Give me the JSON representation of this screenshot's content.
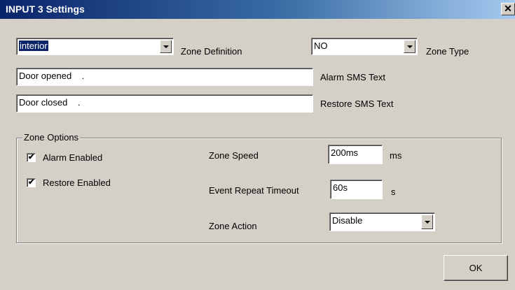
{
  "window": {
    "title": "INPUT 3 Settings",
    "close_glyph": "✕"
  },
  "zone_definition": {
    "value": "interior",
    "label": "Zone Definition"
  },
  "zone_type": {
    "value": "NO",
    "label": "Zone Type"
  },
  "alarm_sms": {
    "value": "Door opened    .",
    "label": "Alarm SMS Text"
  },
  "restore_sms": {
    "value": "Door closed    .",
    "label": "Restore SMS Text"
  },
  "zone_options": {
    "legend": "Zone Options",
    "alarm_enabled": {
      "label": "Alarm Enabled",
      "checked": true,
      "mark": "✔"
    },
    "restore_enabled": {
      "label": "Restore Enabled",
      "checked": true,
      "mark": "✔"
    },
    "zone_speed": {
      "label": "Zone Speed",
      "value": "200ms",
      "unit": "ms"
    },
    "event_repeat_timeout": {
      "label": "Event Repeat Timeout",
      "value": "60s",
      "unit": "s"
    },
    "zone_action": {
      "label": "Zone Action",
      "value": "Disable"
    }
  },
  "buttons": {
    "ok": "OK"
  },
  "icons": {
    "dropdown_arrow": "chevron-down-icon",
    "close": "close-icon"
  },
  "colors": {
    "dialog_bg": "#d4d0c8",
    "titlebar_start": "#0a246a",
    "titlebar_end": "#a6caf0",
    "selection": "#0a246a"
  }
}
